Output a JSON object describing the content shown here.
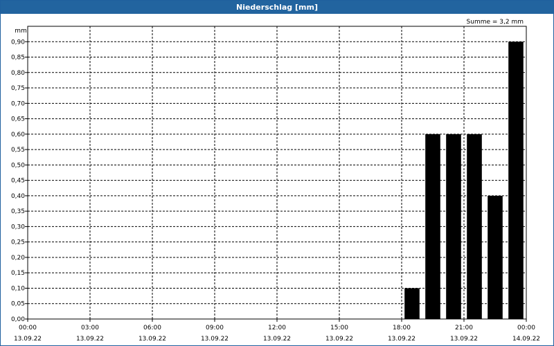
{
  "window": {
    "title": "Niederschlag [mm]"
  },
  "chart_data": {
    "type": "bar",
    "title": "Niederschlag [mm]",
    "ylabel": "mm",
    "annotation": "Summe = 3,2 mm",
    "ylim": [
      0,
      0.95
    ],
    "y_ticks": [
      "0,00",
      "0,05",
      "0,10",
      "0,15",
      "0,20",
      "0,25",
      "0,30",
      "0,35",
      "0,40",
      "0,45",
      "0,50",
      "0,55",
      "0,60",
      "0,65",
      "0,70",
      "0,75",
      "0,80",
      "0,85",
      "0,90"
    ],
    "x_range_hours": [
      0,
      24
    ],
    "x_ticks": [
      {
        "time": "00:00",
        "date": "13.09.22"
      },
      {
        "time": "03:00",
        "date": "13.09.22"
      },
      {
        "time": "06:00",
        "date": "13.09.22"
      },
      {
        "time": "09:00",
        "date": "13.09.22"
      },
      {
        "time": "12:00",
        "date": "13.09.22"
      },
      {
        "time": "15:00",
        "date": "13.09.22"
      },
      {
        "time": "18:00",
        "date": "13.09.22"
      },
      {
        "time": "21:00",
        "date": "13.09.22"
      },
      {
        "time": "00:00",
        "date": "14.09.22"
      }
    ],
    "bars": [
      {
        "time": "18:30",
        "value": 0.1
      },
      {
        "time": "19:30",
        "value": 0.6
      },
      {
        "time": "20:30",
        "value": 0.6
      },
      {
        "time": "21:30",
        "value": 0.6
      },
      {
        "time": "22:30",
        "value": 0.4
      },
      {
        "time": "23:30",
        "value": 0.9
      }
    ],
    "bar_color": "#000000",
    "grid": true
  }
}
